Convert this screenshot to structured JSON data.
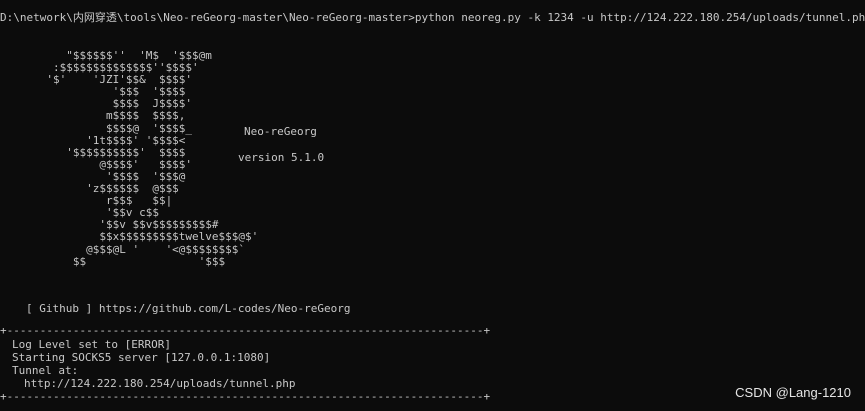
{
  "command_line": "D:\\network\\内网穿透\\tools\\Neo-reGeorg-master\\Neo-reGeorg-master>python neoreg.py -k 1234 -u http://124.222.180.254/uploads/tunnel.php",
  "ascii_logo": "          \"$$$$$$''  'M$  '$$$@m\n        :$$$$$$$$$$$$$$''$$$$'\n       '$'    'JZI'$$&  $$$$'\n                 '$$$  '$$$$\n                 $$$$  J$$$$'\n                m$$$$  $$$$,\n                $$$$@  '$$$$_\n             '1t$$$$' '$$$$<\n          '$$$$$$$$$$'  $$$$\n               @$$$$'   $$$$'\n                '$$$$  '$$$@\n             'z$$$$$$  @$$$\n                r$$$   $$|\n                '$$v c$$\n               '$$v $$v$$$$$$$$$#\n               $$x$$$$$$$$$twelve$$$@$'\n             @$$$@L '    '<@$$$$$$$$`\n           $$                 '$$$",
  "brand": "Neo-reGeorg",
  "version": "version 5.1.0",
  "github": "[ Github ] https://github.com/L-codes/Neo-reGeorg",
  "separator": "+------------------------------------------------------------------------+",
  "log_lines": [
    "Log Level set to [ERROR]",
    "Starting SOCKS5 server [127.0.0.1:1080]",
    "Tunnel at:",
    "http://124.222.180.254/uploads/tunnel.php"
  ],
  "watermark": "CSDN @Lang-1210"
}
